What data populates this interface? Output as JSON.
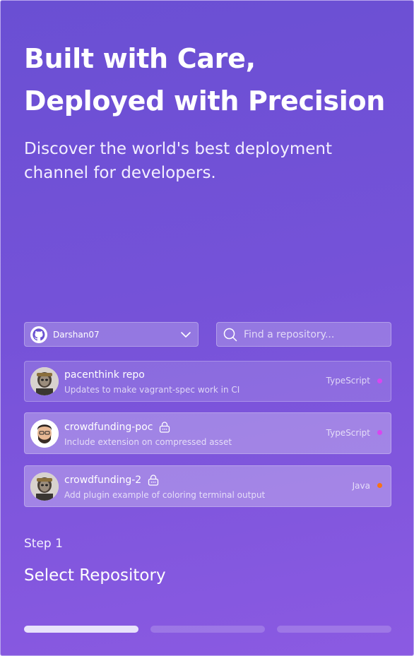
{
  "hero": {
    "title": "Built with Care, Deployed with Precision",
    "subtitle": "Discover the world's best deployment channel for developers."
  },
  "account": {
    "name": "Darshan07",
    "icon": "github-icon"
  },
  "search": {
    "placeholder": "Find a repository...",
    "value": ""
  },
  "repos": [
    {
      "name": "pacenthink repo",
      "description": "Updates to make vagrant-spec work in CI",
      "language": "TypeScript",
      "language_color": "#d946ef",
      "private": false
    },
    {
      "name": "crowdfunding-poc",
      "description": "Include extension on compressed asset",
      "language": "TypeScript",
      "language_color": "#d946ef",
      "private": true
    },
    {
      "name": "crowdfunding-2",
      "description": "Add plugin example of coloring terminal output",
      "language": "Java",
      "language_color": "#f97316",
      "private": true
    }
  ],
  "step": {
    "label": "Step 1",
    "title": "Select Repository",
    "current": 1,
    "total": 3
  },
  "colors": {
    "accent": "#7552d8",
    "progress_active": "#e8e2fb"
  }
}
